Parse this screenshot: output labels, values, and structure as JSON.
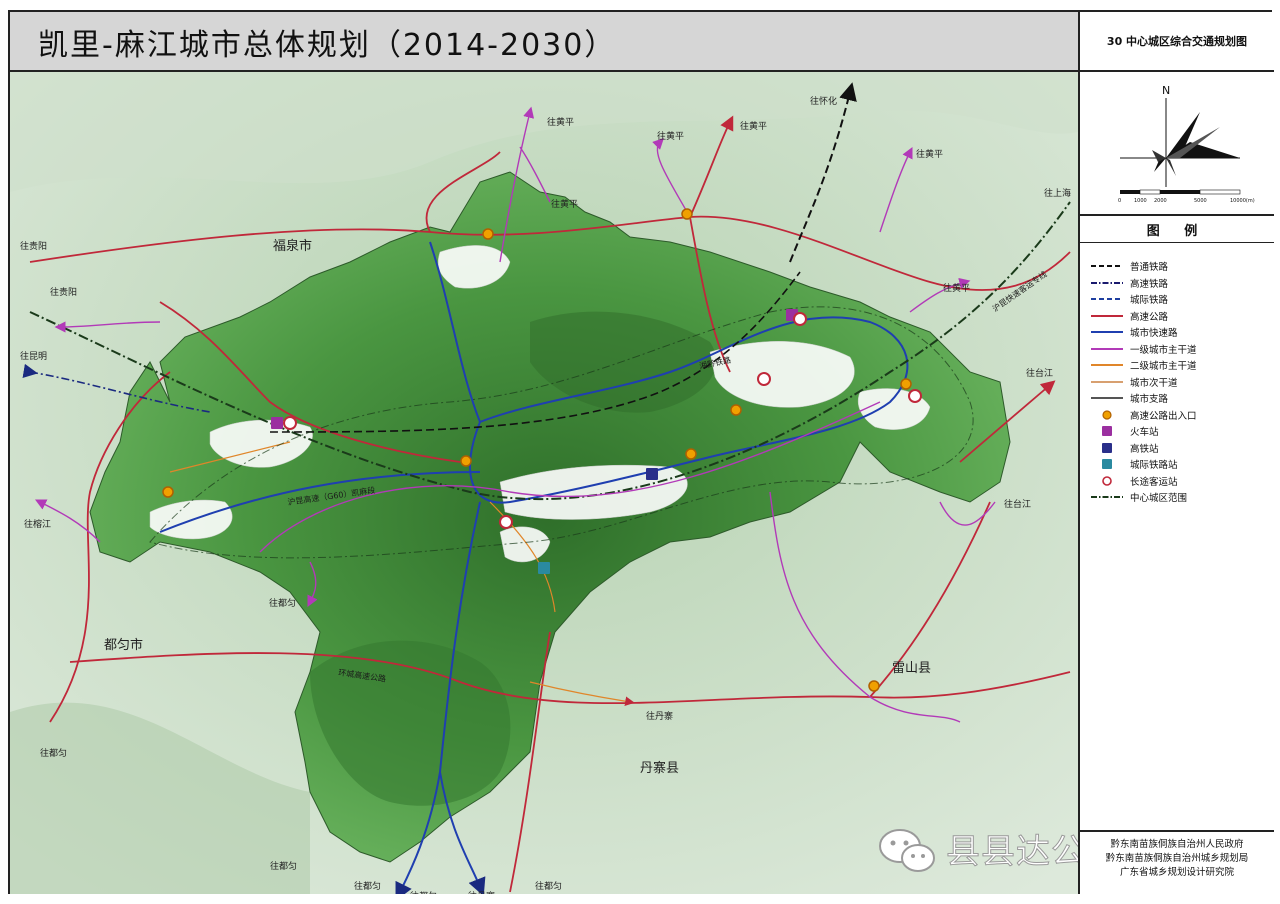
{
  "title": "凯里-麻江城市总体规划（2014-2030）",
  "sheet_title": "30 中心城区综合交通规划图",
  "compass": {
    "north_label": "N",
    "scale_ticks": [
      "0",
      "1000",
      "2000",
      "5000",
      "10000(m)"
    ]
  },
  "legend": {
    "heading": "图 例",
    "items": [
      {
        "label": "普通铁路",
        "symbol": "line-dashed",
        "color": "#111111"
      },
      {
        "label": "高速铁路",
        "symbol": "line-dash-dot",
        "color": "#1a1a6e"
      },
      {
        "label": "城际铁路",
        "symbol": "line-dashed",
        "color": "#1f3fa0"
      },
      {
        "label": "高速公路",
        "symbol": "line-solid",
        "color": "#c0283a"
      },
      {
        "label": "城市快速路",
        "symbol": "line-solid",
        "color": "#1f3fb0"
      },
      {
        "label": "一级城市主干道",
        "symbol": "line-solid",
        "color": "#b23ab8"
      },
      {
        "label": "二级城市主干道",
        "symbol": "line-solid",
        "color": "#e0862a"
      },
      {
        "label": "城市次干道",
        "symbol": "line-solid",
        "color": "#d8a070"
      },
      {
        "label": "城市支路",
        "symbol": "line-solid",
        "color": "#555555"
      },
      {
        "label": "高速公路出入口",
        "symbol": "circle-orange",
        "color": "#f0a000"
      },
      {
        "label": "火车站",
        "symbol": "badge-purple",
        "color": "#9b2fa0"
      },
      {
        "label": "高铁站",
        "symbol": "badge-navy",
        "color": "#2a2f8a"
      },
      {
        "label": "城际铁路站",
        "symbol": "badge-teal",
        "color": "#2a8aa0"
      },
      {
        "label": "长途客运站",
        "symbol": "ring-red",
        "color": "#c0283a"
      },
      {
        "label": "中心城区范围",
        "symbol": "line-dash-dot",
        "color": "#1a3a1a"
      }
    ]
  },
  "credits": [
    "黔东南苗族侗族自治州人民政府",
    "黔东南苗族侗族自治州城乡规划局",
    "广东省城乡规划设计研究院"
  ],
  "map": {
    "region_labels": [
      "福泉市",
      "都匀市",
      "雷山县",
      "丹寨县"
    ],
    "direction_labels": {
      "huangping": "往黄平",
      "huaihua": "往怀化",
      "shanghai": "往上海",
      "guiyang": "往贵阳",
      "kunming": "往昆明",
      "rongjiang": "往榕江",
      "taijiang": "往台江",
      "duyun": "往都匀",
      "danzhai": "往丹寨"
    },
    "road_labels": {
      "huqi": "沪昆高速（G60）凯麻段",
      "huangqi": "沪昆快速客运专线",
      "xiangqian": "湘黔铁路",
      "huancheng": "环城高速公路"
    }
  },
  "watermark": "县县达公益规划",
  "colors": {
    "highway": "#c0283a",
    "expressway": "#1f3fb0",
    "arterial": "#b23ab8",
    "interchange": "#f0a000",
    "terrain": "#4f9a45",
    "background": "#c9dcc7"
  }
}
